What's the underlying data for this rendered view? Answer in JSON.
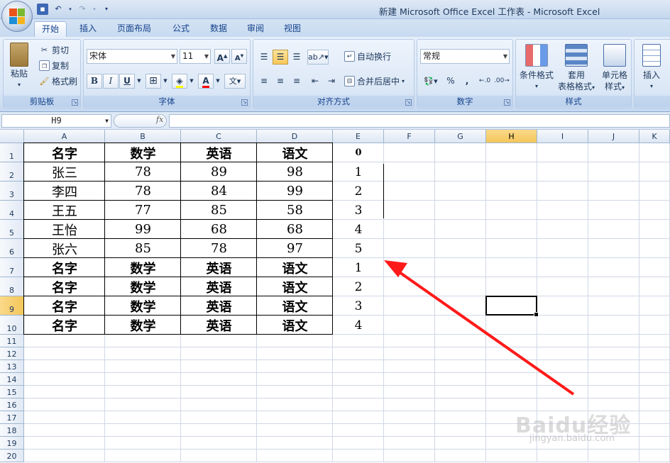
{
  "window": {
    "title": "新建 Microsoft Office Excel 工作表 - Microsoft Excel"
  },
  "ribbon_tabs": [
    "开始",
    "插入",
    "页面布局",
    "公式",
    "数据",
    "审阅",
    "视图"
  ],
  "active_tab": "开始",
  "clipboard": {
    "paste": "粘贴",
    "cut": "剪切",
    "copy": "复制",
    "format_painter": "格式刷",
    "group_label": "剪贴板"
  },
  "font": {
    "family": "宋体",
    "size": "11",
    "bold": "B",
    "italic": "I",
    "underline": "U",
    "group_label": "字体"
  },
  "alignment": {
    "wrap_text": "自动换行",
    "merge_center": "合并后居中",
    "group_label": "对齐方式"
  },
  "number": {
    "format": "常规",
    "percent": "%",
    "comma": ",",
    "group_label": "数字"
  },
  "styles": {
    "conditional": "条件格式",
    "table_line1": "套用",
    "table_line2": "表格格式",
    "cell_line1": "单元格",
    "cell_line2": "样式",
    "group_label": "样式"
  },
  "cells_group": {
    "insert": "插入"
  },
  "formula_bar": {
    "name_box": "H9",
    "fx": "fx",
    "formula": ""
  },
  "columns": [
    "A",
    "B",
    "C",
    "D",
    "E",
    "F",
    "G",
    "H",
    "I",
    "J",
    "K"
  ],
  "rows": [
    "1",
    "2",
    "3",
    "4",
    "5",
    "6",
    "7",
    "8",
    "9",
    "10",
    "11",
    "12",
    "13",
    "14",
    "15",
    "16",
    "17",
    "18",
    "19",
    "20"
  ],
  "table": [
    [
      "名字",
      "数学",
      "英语",
      "语文",
      "0"
    ],
    [
      "张三",
      "78",
      "89",
      "98",
      "1"
    ],
    [
      "李四",
      "78",
      "84",
      "99",
      "2"
    ],
    [
      "王五",
      "77",
      "85",
      "58",
      "3"
    ],
    [
      "王怡",
      "99",
      "68",
      "68",
      "4"
    ],
    [
      "张六",
      "85",
      "78",
      "97",
      "5"
    ],
    [
      "名字",
      "数学",
      "英语",
      "语文",
      "1"
    ],
    [
      "名字",
      "数学",
      "英语",
      "语文",
      "2"
    ],
    [
      "名字",
      "数学",
      "英语",
      "语文",
      "3"
    ],
    [
      "名字",
      "数学",
      "英语",
      "语文",
      "4"
    ]
  ],
  "selected_cell": "H9",
  "watermark": {
    "text": "Baidu经验",
    "url": "jingyan.baidu.com"
  },
  "colors": {
    "arrow": "#ff1a1a",
    "selection_header": "#f4c65a",
    "ribbon": "#dbe7f6"
  }
}
